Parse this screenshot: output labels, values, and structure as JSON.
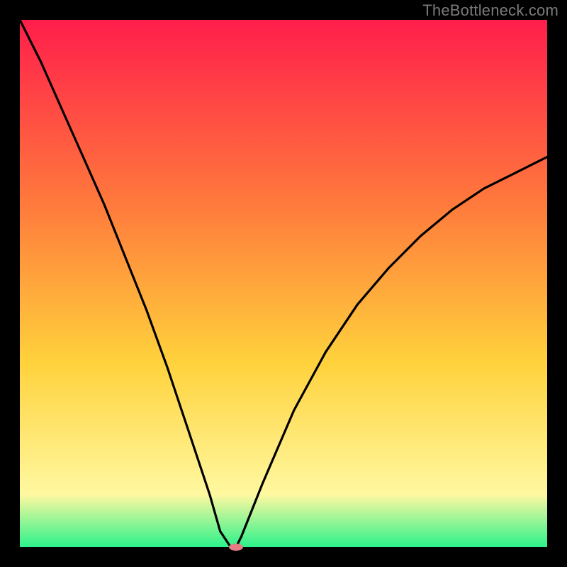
{
  "watermark": "TheBottleneck.com",
  "chart_data": {
    "type": "line",
    "title": "",
    "xlabel": "",
    "ylabel": "",
    "xlim": [
      0,
      100
    ],
    "ylim": [
      0,
      100
    ],
    "grid": false,
    "legend": false,
    "background_gradient": {
      "top": "#ff1e4b",
      "mid1": "#ff7a3c",
      "mid2": "#ffd23c",
      "mid3": "#fff8a0",
      "bottom": "#2cf28b"
    },
    "series": [
      {
        "name": "bottleneck-curve",
        "x": [
          0,
          4,
          8,
          12,
          16,
          20,
          24,
          28,
          32,
          36,
          38,
          40,
          41,
          42,
          46,
          52,
          58,
          64,
          70,
          76,
          82,
          88,
          94,
          100
        ],
        "y": [
          100,
          92,
          83,
          74,
          65,
          55,
          45,
          34,
          22,
          10,
          3,
          0,
          0,
          2,
          12,
          26,
          37,
          46,
          53,
          59,
          64,
          68,
          71,
          74
        ]
      }
    ],
    "marker": {
      "name": "optimum-marker",
      "x": 41,
      "y": 0,
      "color": "#e77b83",
      "rx": 10,
      "ry": 5
    }
  }
}
